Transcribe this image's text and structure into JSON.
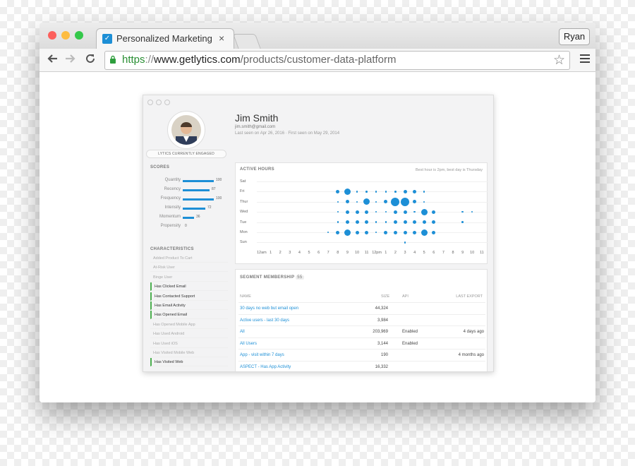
{
  "browser": {
    "tab_title": "Personalized Marketing Sta",
    "user": "Ryan",
    "url_scheme": "https",
    "url_sep": "://",
    "url_host": "www.getlytics.com",
    "url_path": "/products/customer-data-platform"
  },
  "profile": {
    "name": "Jim Smith",
    "email": "jim.smith@gmail.com",
    "seen": "Last seen on Apr 26, 2016 · First seen on May 29, 2014",
    "engaged": "LYTICS CURRENTLY ENGAGED"
  },
  "scores": {
    "title": "SCORES",
    "items": [
      {
        "label": "Quantity",
        "value": 100
      },
      {
        "label": "Recency",
        "value": 87
      },
      {
        "label": "Frequency",
        "value": 100
      },
      {
        "label": "Intensity",
        "value": 72
      },
      {
        "label": "Momentum",
        "value": 36
      },
      {
        "label": "Propensity",
        "value": 0
      }
    ]
  },
  "characteristics": {
    "title": "CHARACTERISTICS",
    "items": [
      {
        "label": "Added Product To Cart",
        "active": false
      },
      {
        "label": "At-Risk User",
        "active": false
      },
      {
        "label": "Binge User",
        "active": false
      },
      {
        "label": "Has Clicked Email",
        "active": true
      },
      {
        "label": "Has Contacted Support",
        "active": true
      },
      {
        "label": "Has Email Activity",
        "active": true
      },
      {
        "label": "Has Opened Email",
        "active": true
      },
      {
        "label": "Has Opened Mobile App",
        "active": false
      },
      {
        "label": "Has Used Android",
        "active": false
      },
      {
        "label": "Has Used iOS",
        "active": false
      },
      {
        "label": "Has Visited Mobile Web",
        "active": false
      },
      {
        "label": "Has Visited Web",
        "active": true
      }
    ]
  },
  "active_hours": {
    "title": "ACTIVE HOURS",
    "note": "Best hour is 2pm, best day is Thursday",
    "days": [
      "Sat",
      "Fri",
      "Thur",
      "Wed",
      "Tue",
      "Mon",
      "Sun"
    ],
    "hours": [
      "12am",
      "1",
      "2",
      "3",
      "4",
      "5",
      "6",
      "7",
      "8",
      "9",
      "10",
      "11",
      "12pm",
      "1",
      "2",
      "3",
      "4",
      "5",
      "6",
      "7",
      "8",
      "9",
      "10",
      "11"
    ],
    "matrix": [
      [
        0,
        0,
        0,
        0,
        0,
        0,
        0,
        0,
        0,
        0,
        0,
        0,
        0,
        0,
        0,
        0,
        0,
        0,
        0,
        0,
        0,
        0,
        0,
        0
      ],
      [
        0,
        0,
        0,
        0,
        0,
        0,
        0,
        0,
        2,
        3,
        1,
        1,
        1,
        1,
        1,
        2,
        2,
        1,
        0,
        0,
        0,
        0,
        0,
        0
      ],
      [
        0,
        0,
        0,
        0,
        0,
        0,
        0,
        0,
        1,
        2,
        1,
        3,
        1,
        2,
        4,
        4,
        2,
        1,
        0,
        0,
        0,
        0,
        0,
        0
      ],
      [
        0,
        0,
        0,
        0,
        0,
        0,
        0,
        0,
        1,
        2,
        2,
        2,
        1,
        1,
        2,
        2,
        1,
        3,
        2,
        0,
        0,
        1,
        1,
        0
      ],
      [
        0,
        0,
        0,
        0,
        0,
        0,
        0,
        0,
        1,
        2,
        2,
        2,
        1,
        1,
        2,
        2,
        2,
        2,
        2,
        0,
        0,
        1,
        0,
        0
      ],
      [
        0,
        0,
        0,
        0,
        0,
        0,
        0,
        1,
        2,
        3,
        2,
        2,
        1,
        2,
        2,
        2,
        2,
        3,
        2,
        0,
        0,
        0,
        0,
        0
      ],
      [
        0,
        0,
        0,
        0,
        0,
        0,
        0,
        0,
        0,
        0,
        0,
        0,
        0,
        0,
        0,
        1,
        0,
        0,
        0,
        0,
        0,
        0,
        0,
        0
      ]
    ]
  },
  "segments": {
    "title": "SEGMENT MEMBERSHIP",
    "count": "55",
    "headers": {
      "name": "NAME",
      "size": "SIZE",
      "api": "API",
      "last_export": "LAST EXPORT"
    },
    "rows": [
      {
        "name": "30 days no web but email open",
        "size": "44,324",
        "api": "",
        "last_export": ""
      },
      {
        "name": "Active users - last 30 days",
        "size": "3,984",
        "api": "",
        "last_export": ""
      },
      {
        "name": "All",
        "size": "203,969",
        "api": "Enabled",
        "last_export": "4 days ago"
      },
      {
        "name": "All Users",
        "size": "3,144",
        "api": "Enabled",
        "last_export": ""
      },
      {
        "name": "App - visit within 7 days",
        "size": "190",
        "api": "",
        "last_export": "4 months ago"
      },
      {
        "name": "ASPECT - Has App Activity",
        "size": "16,332",
        "api": "",
        "last_export": ""
      }
    ]
  },
  "colors": {
    "accent": "#1d8fd6",
    "active_marker": "#4caf50"
  },
  "icons": [
    "back-arrow-icon",
    "forward-arrow-icon",
    "reload-icon",
    "lock-icon",
    "star-icon",
    "menu-icon",
    "chat-icon"
  ]
}
